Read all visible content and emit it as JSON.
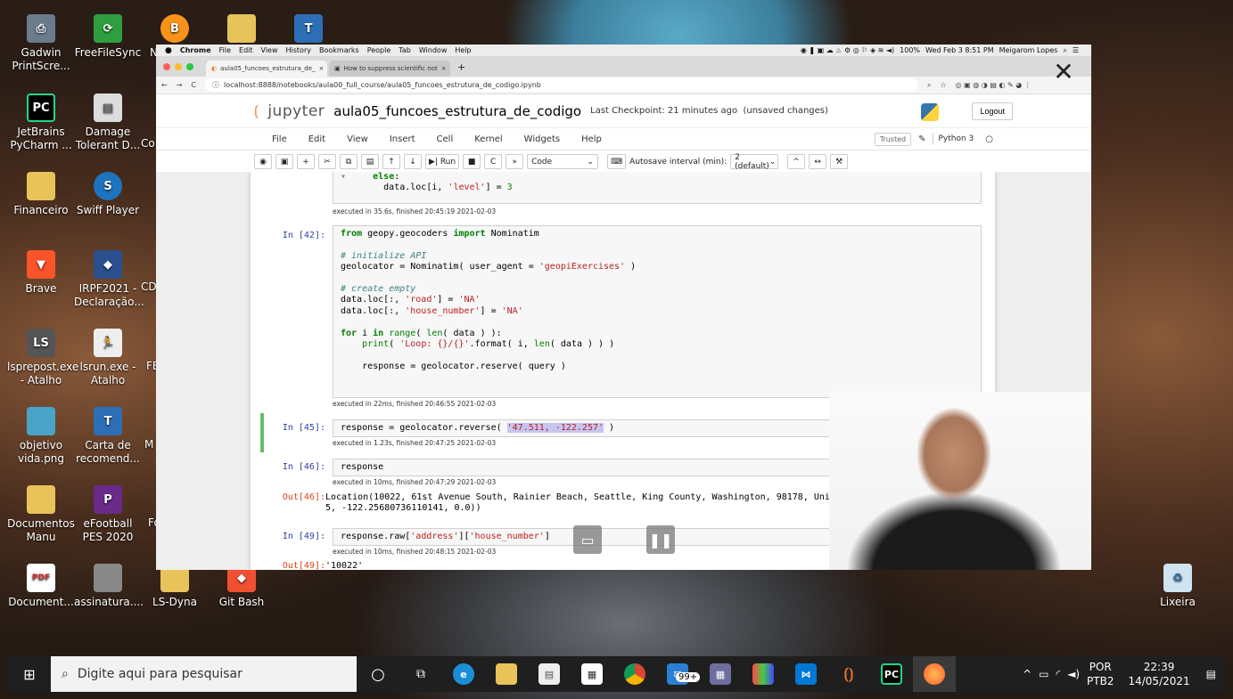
{
  "desktop_icons": [
    {
      "label": "Gadwin PrintScre...",
      "icon": "printscreen-icon",
      "color": "#6a7b8c"
    },
    {
      "label": "FreeFileSync",
      "icon": "sync-icon",
      "color": "#2e9e3e"
    },
    {
      "label": "JetBrains PyCharm ...",
      "icon": "pycharm-icon",
      "color": "#21d789"
    },
    {
      "label": "Damage Tolerant D...",
      "icon": "document-icon",
      "color": "#ddd"
    },
    {
      "label": "Financeiro",
      "icon": "folder-icon",
      "color": "#e8c35a"
    },
    {
      "label": "Swiff Player",
      "icon": "swiff-icon",
      "color": "#1e73be"
    },
    {
      "label": "Brave",
      "icon": "brave-icon",
      "color": "#fb542b"
    },
    {
      "label": "IRPF2021 - Declaração...",
      "icon": "irpf-icon",
      "color": "#2a4f8f"
    },
    {
      "label": "lsprepost.exe - Atalho",
      "icon": "lsprepost-icon",
      "color": "#555"
    },
    {
      "label": "lsrun.exe - Atalho",
      "icon": "lsrun-icon",
      "color": "#eee"
    },
    {
      "label": "objetivo vida.png",
      "icon": "image-icon",
      "color": "#4aa3c8"
    },
    {
      "label": "Carta de recomend...",
      "icon": "text-icon",
      "color": "#2d6fb6"
    },
    {
      "label": "Documentos Manu",
      "icon": "folder-icon",
      "color": "#e8c35a"
    },
    {
      "label": "eFootball PES 2020",
      "icon": "pes-icon",
      "color": "#6a2a8a"
    },
    {
      "label": "Document...",
      "icon": "pdf-icon",
      "color": "#d32f2f"
    },
    {
      "label": "assinatura....",
      "icon": "image-icon",
      "color": "#888"
    },
    {
      "label": "LS-Dyna",
      "icon": "folder-icon",
      "color": "#e8c35a"
    },
    {
      "label": "Git Bash",
      "icon": "git-icon",
      "color": "#f05032"
    },
    {
      "label": "Lixeira",
      "icon": "recycle-bin-icon",
      "color": "#cfe3f0"
    }
  ],
  "desktop_partial": {
    "c1": "Co",
    "c2": "CD",
    "c3": "FE",
    "c4": "M",
    "c5": "Fo",
    "c6": "N"
  },
  "mac_menubar": {
    "apple": "",
    "app": "Chrome",
    "items": [
      "File",
      "Edit",
      "View",
      "History",
      "Bookmarks",
      "People",
      "Tab",
      "Window",
      "Help"
    ],
    "battery": "100%",
    "datetime": "Wed Feb 3  8:51 PM",
    "user": "Meigarom Lopes"
  },
  "tabs": [
    {
      "title": "aula05_funcoes_estrutura_de_",
      "close": "×"
    },
    {
      "title": "How to suppress scientific not",
      "close": "×"
    }
  ],
  "new_tab": "+",
  "address": {
    "url": "localhost:8888/notebooks/aula00_full_course/aula05_funcoes_estrutura_de_codigo.ipynb"
  },
  "jupyter": {
    "logo_text": "jupyter",
    "notebook_name": "aula05_funcoes_estrutura_de_codigo",
    "checkpoint": "Last Checkpoint: 21 minutes ago",
    "unsaved": "(unsaved changes)",
    "logout": "Logout",
    "menu": [
      "File",
      "Edit",
      "View",
      "Insert",
      "Cell",
      "Kernel",
      "Widgets",
      "Help"
    ],
    "trusted": "Trusted",
    "kernel": "Python 3",
    "toolbar": {
      "run": "Run",
      "cell_type": "Code",
      "autosave_label": "Autosave interval (min):",
      "autosave_value": "2 (default)"
    }
  },
  "cells": [
    {
      "exec": "executed in 35.6s, finished 20:45:19 2021-02-03"
    },
    {
      "prompt": "In [42]:",
      "exec": "executed in 22ms, finished 20:46:55 2021-02-03"
    },
    {
      "prompt": "In [45]:",
      "exec": "executed in 1.23s, finished 20:47:25 2021-02-03"
    },
    {
      "prompt": "In [46]:",
      "code": "response",
      "exec": "executed in 10ms, finished 20:47:29 2021-02-03",
      "out_prompt": "Out[46]:",
      "output": "Location(10022, 61st Avenue South, Rainier Beach, Seattle, King County, Washington, 98178, United States, (47\n5, -122.25680736110141, 0.0))"
    },
    {
      "prompt": "In [49]:",
      "exec": "executed in 10ms, finished 20:48:15 2021-02-03",
      "out_prompt": "Out[49]:",
      "output": "'10022'"
    }
  ],
  "taskbar": {
    "search_placeholder": "Digite aqui para pesquisar",
    "mail_badge": "99+",
    "lang1": "POR",
    "lang2": "PTB2",
    "time": "22:39",
    "date": "14/05/2021"
  }
}
